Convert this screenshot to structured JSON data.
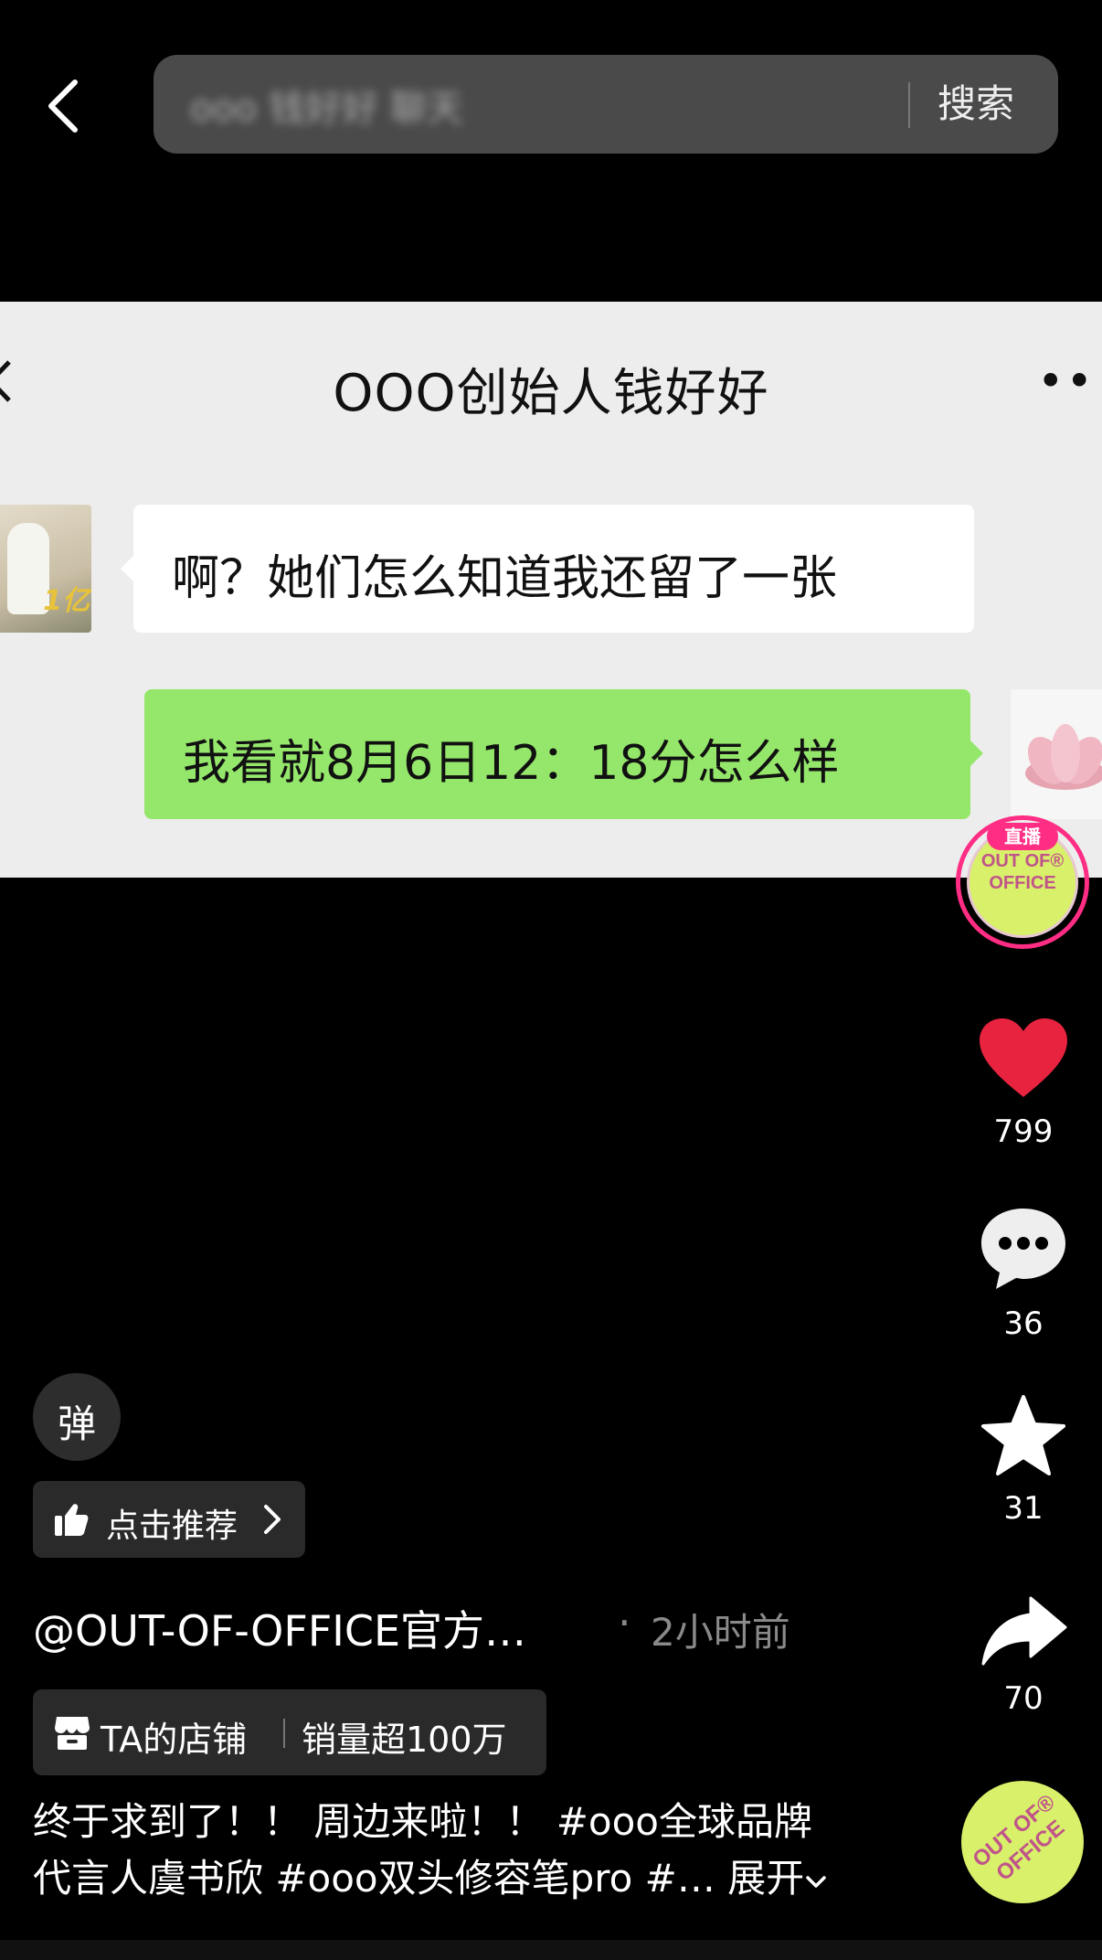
{
  "search": {
    "query": "ooo 钱好好 聊天",
    "button_label": "搜索"
  },
  "chat": {
    "title": "OOO创始人钱好好",
    "more": "••",
    "message_left": "啊？她们怎么知道我还留了一张",
    "message_right": "我看就8月6日12：18分怎么样",
    "avatar_left_tag": "1亿"
  },
  "live": {
    "badge": "直播",
    "logo_line1": "OUT OF®",
    "logo_line2": "OFFICE"
  },
  "actions": {
    "likes": "799",
    "comments": "36",
    "favorites": "31",
    "shares": "70"
  },
  "danmu": {
    "label": "弹"
  },
  "recommend": {
    "label": "点击推荐"
  },
  "author": {
    "name": "@OUT-OF-OFFICE官方…",
    "separator": "·",
    "time": "2小时前"
  },
  "shop": {
    "label": "TA的店铺",
    "sales": "销量超100万"
  },
  "caption": {
    "line1": "终于求到了！！ 周边来啦！！  #ooo全球品牌",
    "line2": "代言人虞书欣 #ooo双头修容笔pro #…",
    "expand": "展开"
  },
  "music": {
    "line1": "OUT OF®",
    "line2": "OFFICE"
  },
  "colors": {
    "like_red": "#e8233f",
    "live_pink": "#ff2d84",
    "brand_lime": "#d8f06a",
    "wechat_green": "#95e76b"
  }
}
